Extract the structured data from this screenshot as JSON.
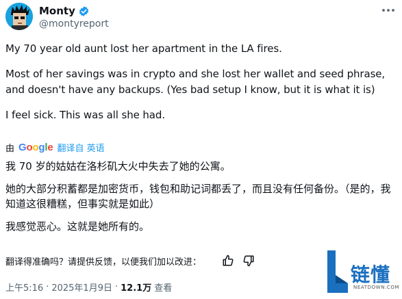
{
  "author": {
    "name": "Monty",
    "handle": "@montyreport"
  },
  "tweet": {
    "p1": "My 70 year old aunt lost her apartment in the LA fires.",
    "p2": "Most of her savings was in crypto and she lost her wallet and seed phrase, and doesn't have any backups. (Yes bad setup I know, but it is what it is)",
    "p3": "I feel sick. This was all she had."
  },
  "translation": {
    "by": "由",
    "provider": "Google",
    "translated_from": "翻译自 英语",
    "p1": "我 70 岁的姑姑在洛杉矶大火中失去了她的公寓。",
    "p2": "她的大部分积蓄都是加密货币，钱包和助记词都丢了，而且没有任何备份。（是的，我知道这很糟糕，但事实就是如此）",
    "p3": "我感觉恶心。这就是她所有的。"
  },
  "feedback": {
    "prompt": "翻译得准确吗？请提供反馈，以便我们加以改进："
  },
  "meta": {
    "time": "上午5:16",
    "separator1": "·",
    "date": "2025年1月9日",
    "separator2": "·",
    "views": "12.1万",
    "views_label": "查看"
  },
  "watermark": {
    "title": "链懂",
    "subtitle": "NEATDOWN.COM"
  },
  "colors": {
    "accent": "#1d9bf0",
    "secondary_text": "#536471",
    "watermark_blue": "#1a6fbf"
  },
  "icons": [
    "verified-badge-icon",
    "more-options-icon",
    "thumbs-up-icon",
    "thumbs-down-icon"
  ]
}
